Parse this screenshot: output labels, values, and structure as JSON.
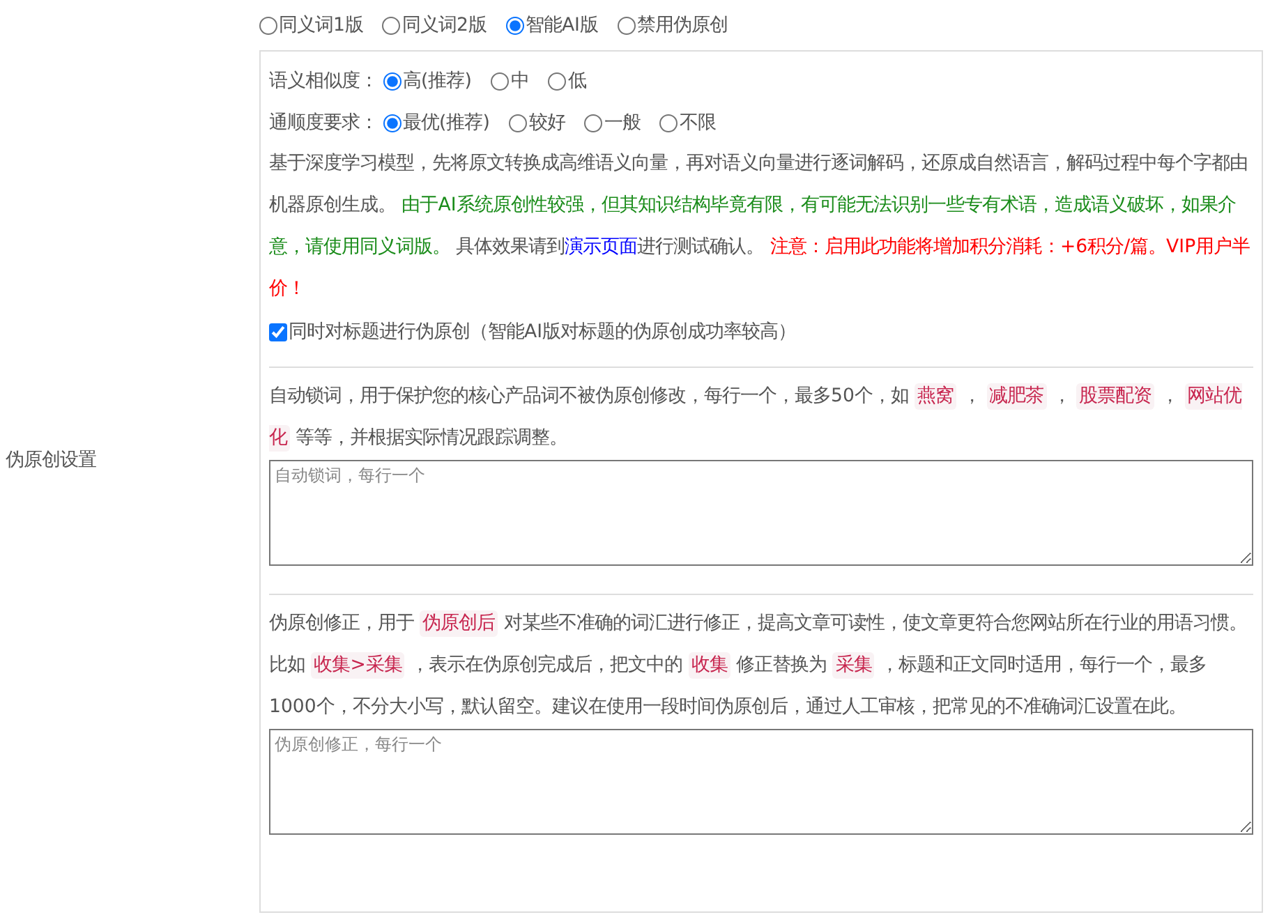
{
  "section_label": "伪原创设置",
  "modes": [
    {
      "label": "同义词1版",
      "selected": false
    },
    {
      "label": "同义词2版",
      "selected": false
    },
    {
      "label": "智能AI版",
      "selected": true
    },
    {
      "label": "禁用伪原创",
      "selected": false
    }
  ],
  "similarity": {
    "label": "语义相似度：",
    "options": [
      {
        "label": "高(推荐)",
        "selected": true
      },
      {
        "label": "中",
        "selected": false
      },
      {
        "label": "低",
        "selected": false
      }
    ]
  },
  "fluency": {
    "label": "通顺度要求：",
    "options": [
      {
        "label": "最优(推荐)",
        "selected": true
      },
      {
        "label": "较好",
        "selected": false
      },
      {
        "label": "一般",
        "selected": false
      },
      {
        "label": "不限",
        "selected": false
      }
    ]
  },
  "ai_description": [
    {
      "kind": "plain",
      "text": "基于深度学习模型，先将原文转换成高维语义向量，再对语义向量进行逐词解码，还原成自然语言，解码过程中每个字都由机器原创生成。 "
    },
    {
      "kind": "green",
      "text": "由于AI系统原创性较强，但其知识结构毕竟有限，有可能无法识别一些专有术语，造成语义破坏，如果介意，请使用同义词版。"
    },
    {
      "kind": "plain",
      "text": " 具体效果请到"
    },
    {
      "kind": "link",
      "text": "演示页面"
    },
    {
      "kind": "plain",
      "text": "进行测试确认。 "
    },
    {
      "kind": "red",
      "text": "注意：启用此功能将增加积分消耗：+6积分/篇。VIP用户半价！"
    }
  ],
  "title_option": {
    "label": "同时对标题进行伪原创（智能AI版对标题的伪原创成功率较高）",
    "checked": true
  },
  "lock_words": {
    "description": [
      {
        "kind": "plain",
        "text": "自动锁词，用于保护您的核心产品词不被伪原创修改，每行一个，最多50个，如 "
      },
      {
        "kind": "code",
        "text": "燕窝"
      },
      {
        "kind": "plain",
        "text": " ， "
      },
      {
        "kind": "code",
        "text": "减肥茶"
      },
      {
        "kind": "plain",
        "text": " ， "
      },
      {
        "kind": "code",
        "text": "股票配资"
      },
      {
        "kind": "plain",
        "text": " ， "
      },
      {
        "kind": "code",
        "text": "网站优化"
      },
      {
        "kind": "plain",
        "text": " 等等，并根据实际情况跟踪调整。"
      }
    ],
    "placeholder": "自动锁词，每行一个"
  },
  "corrections": {
    "description": [
      {
        "kind": "plain",
        "text": "伪原创修正，用于 "
      },
      {
        "kind": "code",
        "text": "伪原创后"
      },
      {
        "kind": "plain",
        "text": " 对某些不准确的词汇进行修正，提高文章可读性，使文章更符合您网站所在行业的用语习惯。比如 "
      },
      {
        "kind": "code",
        "text": "收集>采集"
      },
      {
        "kind": "plain",
        "text": " ，表示在伪原创完成后，把文中的 "
      },
      {
        "kind": "code",
        "text": "收集"
      },
      {
        "kind": "plain",
        "text": " 修正替换为 "
      },
      {
        "kind": "code",
        "text": "采集"
      },
      {
        "kind": "plain",
        "text": " ，标题和正文同时适用，每行一个，最多1000个，不分大小写，默认留空。建议在使用一段时间伪原创后，通过人工审核，把常见的不准确词汇设置在此。"
      }
    ],
    "placeholder": "伪原创修正，每行一个"
  }
}
